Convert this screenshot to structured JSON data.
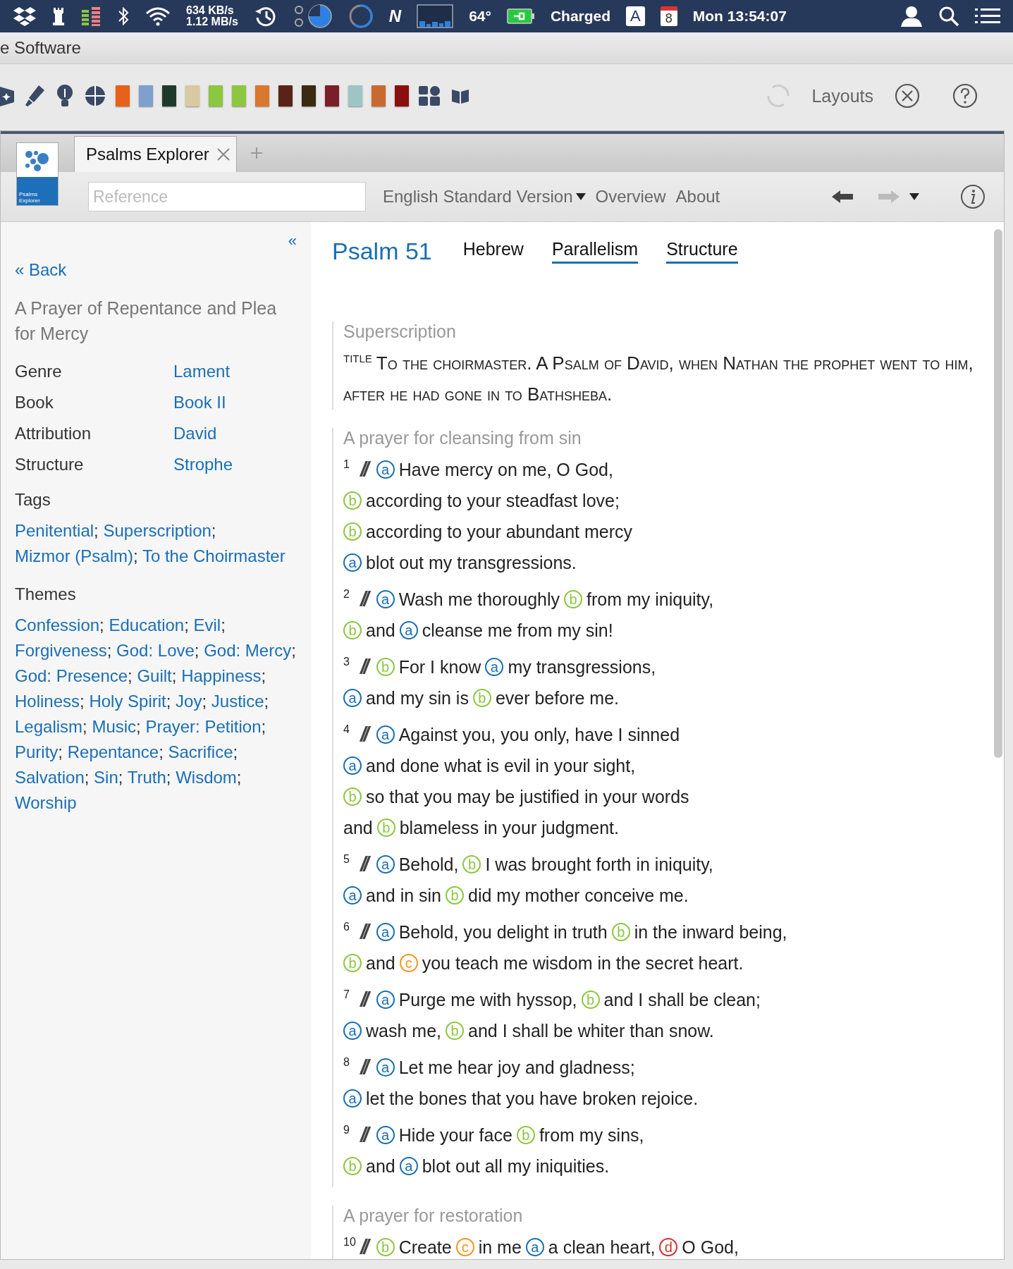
{
  "menu_bar": {
    "network_up": "634 KB/s",
    "network_down": "1.12 MB/s",
    "activity_letter": "N",
    "temperature": "64°",
    "battery": "Charged",
    "input_source": "A",
    "calendar_day": "8",
    "clock": "Mon 13:54:07"
  },
  "app_title": "e Software",
  "toolbar": {
    "books": [
      {
        "color": "#e8611a"
      },
      {
        "color": "#7f9fcc"
      },
      {
        "color": "#1f3a2d"
      },
      {
        "color": "#d9c9a0"
      },
      {
        "color": "#8dc63f"
      },
      {
        "color": "#8dc63f"
      },
      {
        "color": "#d9772e"
      },
      {
        "color": "#5a2318"
      },
      {
        "color": "#3a2a10"
      },
      {
        "color": "#7a1f2a"
      },
      {
        "color": "#9fc4c4"
      },
      {
        "color": "#c86a30"
      },
      {
        "color": "#8a1010"
      }
    ],
    "layouts": "Layouts"
  },
  "panel": {
    "logo_text": "Psalms Explorer",
    "tabs": [
      {
        "label": "Psalms Explorer",
        "selected": true
      }
    ],
    "reference": {
      "placeholder": "Reference"
    },
    "version": "English Standard Version",
    "links": [
      "Overview",
      "About"
    ]
  },
  "sidebar": {
    "collapse": "«",
    "back": "« Back",
    "title": "A Prayer of Repentance and Plea for Mercy",
    "facts": [
      {
        "label": "Genre",
        "value": "Lament"
      },
      {
        "label": "Book",
        "value": "Book II"
      },
      {
        "label": "Attribution",
        "value": "David"
      },
      {
        "label": "Structure",
        "value": "Strophe"
      }
    ],
    "tags_heading": "Tags",
    "tags": [
      {
        "text": "Penitential",
        "punct": ";"
      },
      {
        "text": "Superscription",
        "punct": ";"
      },
      {
        "text": "Mizmor (Psalm)",
        "punct": ";"
      },
      {
        "text": "To the Choirmaster"
      }
    ],
    "themes_heading": "Themes",
    "themes": [
      {
        "text": "Confession",
        "punct": ";"
      },
      {
        "text": "Education",
        "punct": ";"
      },
      {
        "text": "Evil",
        "punct": ";"
      },
      {
        "text": "Forgiveness",
        "punct": ";"
      },
      {
        "text": "God: Love",
        "punct": ";"
      },
      {
        "text": "God: Mercy",
        "punct": ";"
      },
      {
        "text": "God: Presence",
        "punct": ";"
      },
      {
        "text": "Guilt",
        "punct": ";"
      },
      {
        "text": "Happiness",
        "punct": ";"
      },
      {
        "text": "Holiness",
        "punct": ";"
      },
      {
        "text": "Holy Spirit",
        "punct": ";"
      },
      {
        "text": "Joy",
        "punct": ";"
      },
      {
        "text": "Justice",
        "punct": ";"
      },
      {
        "text": "Legalism",
        "punct": ";"
      },
      {
        "text": "Music",
        "punct": ";"
      },
      {
        "text": "Prayer: Petition",
        "punct": ";"
      },
      {
        "text": "Purity",
        "punct": ";"
      },
      {
        "text": "Repentance",
        "punct": ";"
      },
      {
        "text": "Sacrifice",
        "punct": ";"
      },
      {
        "text": "Salvation",
        "punct": ";"
      },
      {
        "text": "Sin",
        "punct": ";"
      },
      {
        "text": "Truth",
        "punct": ";"
      },
      {
        "text": "Wisdom",
        "punct": ";"
      },
      {
        "text": "Worship"
      }
    ]
  },
  "main": {
    "title": "Psalm 51",
    "view_tabs": [
      {
        "label": "Hebrew",
        "on": false
      },
      {
        "label": "Parallelism",
        "on": true
      },
      {
        "label": "Structure",
        "on": true
      }
    ],
    "sections": [
      {
        "kind": "superscription",
        "heading": "Superscription",
        "label": "TITLE",
        "text": "To the choirmaster. A Psalm of David, when Nathan the prophet went to him, after he had gone in to Bathsheba."
      },
      {
        "kind": "verses",
        "heading": "A prayer for cleansing from sin",
        "verses": [
          {
            "number": "1",
            "sep": "//",
            "lines": [
              [
                {
                  "label": "a",
                  "color": "#1a6eb4"
                },
                "Have mercy on me, O God,"
              ],
              [
                {
                  "label": "b",
                  "color": "#8cc63f"
                },
                "according to your steadfast love;"
              ],
              [
                {
                  "label": "b",
                  "color": "#8cc63f"
                },
                "according to your abundant mercy"
              ],
              [
                {
                  "label": "a",
                  "color": "#1a6eb4"
                },
                "blot out my transgressions."
              ]
            ]
          },
          {
            "number": "2",
            "sep": "//",
            "lines": [
              [
                {
                  "label": "a",
                  "color": "#1a6eb4"
                },
                "Wash me thoroughly",
                {
                  "label": "b",
                  "color": "#8cc63f"
                },
                "from my iniquity,"
              ],
              [
                {
                  "label": "b",
                  "color": "#8cc63f"
                },
                "and",
                {
                  "label": "a",
                  "color": "#1a6eb4"
                },
                "cleanse me from my sin!"
              ]
            ]
          },
          {
            "number": "3",
            "sep": "//",
            "lines": [
              [
                {
                  "label": "b",
                  "color": "#8cc63f"
                },
                "For I know",
                {
                  "label": "a",
                  "color": "#1a6eb4"
                },
                "my transgressions,"
              ],
              [
                {
                  "label": "a",
                  "color": "#1a6eb4"
                },
                "and my sin is",
                {
                  "label": "b",
                  "color": "#8cc63f"
                },
                "ever before me."
              ]
            ]
          },
          {
            "number": "4",
            "sep": "//",
            "lines": [
              [
                {
                  "label": "a",
                  "color": "#1a6eb4"
                },
                "Against you, you only, have I sinned"
              ],
              [
                {
                  "label": "a",
                  "color": "#1a6eb4"
                },
                "and done what is evil in your sight,"
              ],
              [
                {
                  "label": "b",
                  "color": "#8cc63f"
                },
                "so that you may be justified in your words"
              ],
              [
                "and",
                {
                  "label": "b",
                  "color": "#8cc63f"
                },
                "blameless in your judgment."
              ]
            ]
          },
          {
            "number": "5",
            "sep": "//",
            "lines": [
              [
                {
                  "label": "a",
                  "color": "#1a6eb4"
                },
                "Behold,",
                {
                  "label": "b",
                  "color": "#8cc63f"
                },
                "I was brought forth in iniquity,"
              ],
              [
                {
                  "label": "a",
                  "color": "#1a6eb4"
                },
                "and in sin",
                {
                  "label": "b",
                  "color": "#8cc63f"
                },
                "did my mother conceive me."
              ]
            ]
          },
          {
            "number": "6",
            "sep": "//",
            "lines": [
              [
                {
                  "label": "a",
                  "color": "#1a6eb4"
                },
                "Behold, you delight in truth",
                {
                  "label": "b",
                  "color": "#8cc63f"
                },
                "in the inward being,"
              ],
              [
                {
                  "label": "b",
                  "color": "#8cc63f"
                },
                "and",
                {
                  "label": "c",
                  "color": "#f7941d"
                },
                "you teach me wisdom in the secret heart."
              ]
            ]
          },
          {
            "number": "7",
            "sep": "//",
            "lines": [
              [
                {
                  "label": "a",
                  "color": "#1a6eb4"
                },
                "Purge me with hyssop,",
                {
                  "label": "b",
                  "color": "#8cc63f"
                },
                "and I shall be clean;"
              ],
              [
                {
                  "label": "a",
                  "color": "#1a6eb4"
                },
                "wash me,",
                {
                  "label": "b",
                  "color": "#8cc63f"
                },
                "and I shall be whiter than snow."
              ]
            ]
          },
          {
            "number": "8",
            "sep": "//",
            "lines": [
              [
                {
                  "label": "a",
                  "color": "#1a6eb4"
                },
                "Let me hear joy and gladness;"
              ],
              [
                {
                  "label": "a",
                  "color": "#1a6eb4"
                },
                "let the bones that you have broken rejoice."
              ]
            ]
          },
          {
            "number": "9",
            "sep": "//",
            "lines": [
              [
                {
                  "label": "a",
                  "color": "#1a6eb4"
                },
                "Hide your face",
                {
                  "label": "b",
                  "color": "#8cc63f"
                },
                "from my sins,"
              ],
              [
                {
                  "label": "b",
                  "color": "#8cc63f"
                },
                "and",
                {
                  "label": "a",
                  "color": "#1a6eb4"
                },
                "blot out all my iniquities."
              ]
            ]
          }
        ]
      },
      {
        "kind": "verses",
        "heading": "A prayer for restoration",
        "verses": [
          {
            "number": "10",
            "sep": "//",
            "lines": [
              [
                {
                  "label": "b",
                  "color": "#8cc63f"
                },
                "Create",
                {
                  "label": "c",
                  "color": "#f7941d"
                },
                "in me",
                {
                  "label": "a",
                  "color": "#1a6eb4"
                },
                "a clean heart,",
                {
                  "label": "d",
                  "color": "#d0312d"
                },
                "O God,"
              ]
            ]
          }
        ]
      }
    ]
  }
}
